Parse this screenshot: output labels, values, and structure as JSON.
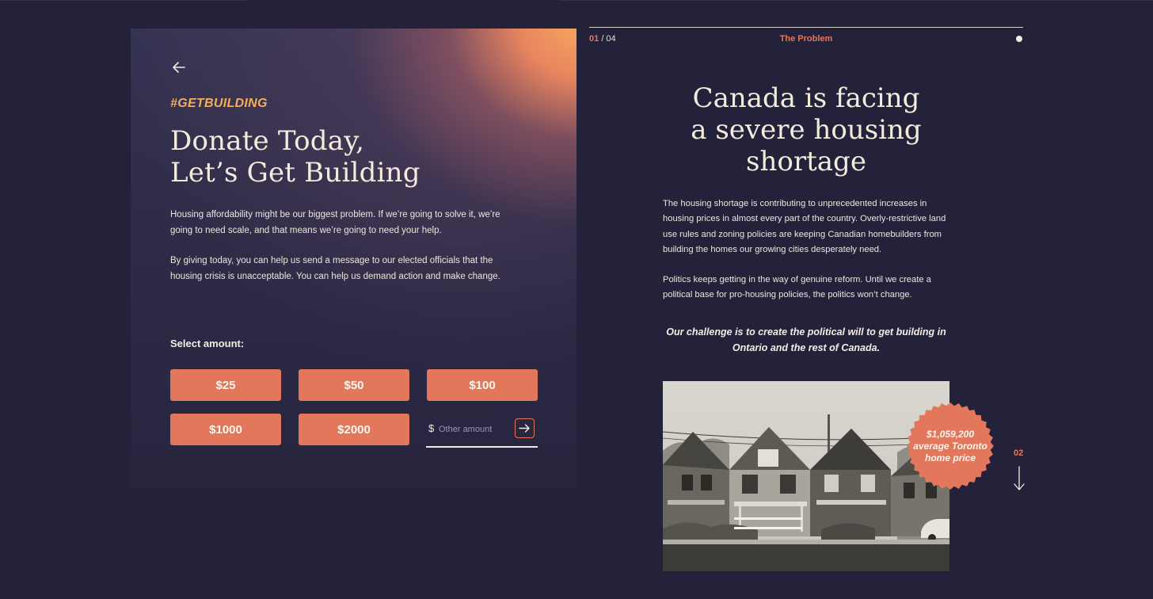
{
  "donate": {
    "hashtag": "#GETBUILDING",
    "title_line1": "Donate Today,",
    "title_line2": "Let’s Get Building",
    "paragraph1": "Housing affordability might be our biggest problem. If we’re going to solve it, we’re going to need scale, and that means we’re going to need your help.",
    "paragraph2": "By giving today, you can help us send a message to our elected officials that the housing crisis is unacceptable. You can help us demand action and make change.",
    "select_label": "Select amount:",
    "amounts": [
      "$25",
      "$50",
      "$100",
      "$1000",
      "$2000"
    ],
    "currency_symbol": "$",
    "other_placeholder": "Other amount",
    "back_icon": "arrow-left-icon",
    "submit_icon": "arrow-right-icon"
  },
  "problem": {
    "page_current": "01",
    "page_total": "/ 04",
    "section_label": "The Problem",
    "title_line1": "Canada is facing",
    "title_line2": "a severe housing",
    "title_line3": "shortage",
    "paragraph1": "The housing shortage is contributing to unprecedented increases in housing prices in almost every part of the country. Overly-restrictive land use rules and zoning policies are keeping Canadian homebuilders from building the homes our growing cities desperately need.",
    "paragraph2": "Politics keeps getting in the way of genuine reform. Until we create a political base for pro-housing policies, the politics won’t change.",
    "challenge": "Our challenge is to create the political will to get building in Ontario and the rest of Canada.",
    "badge_line1": "$1,059,200",
    "badge_line2": "average Toronto",
    "badge_line3": "home price",
    "next_page": "02",
    "next_icon": "arrow-down-icon"
  },
  "colors": {
    "background": "#24223a",
    "accent": "#e3775b",
    "hashtag": "#f4ae59",
    "text": "#f3ebdc"
  }
}
